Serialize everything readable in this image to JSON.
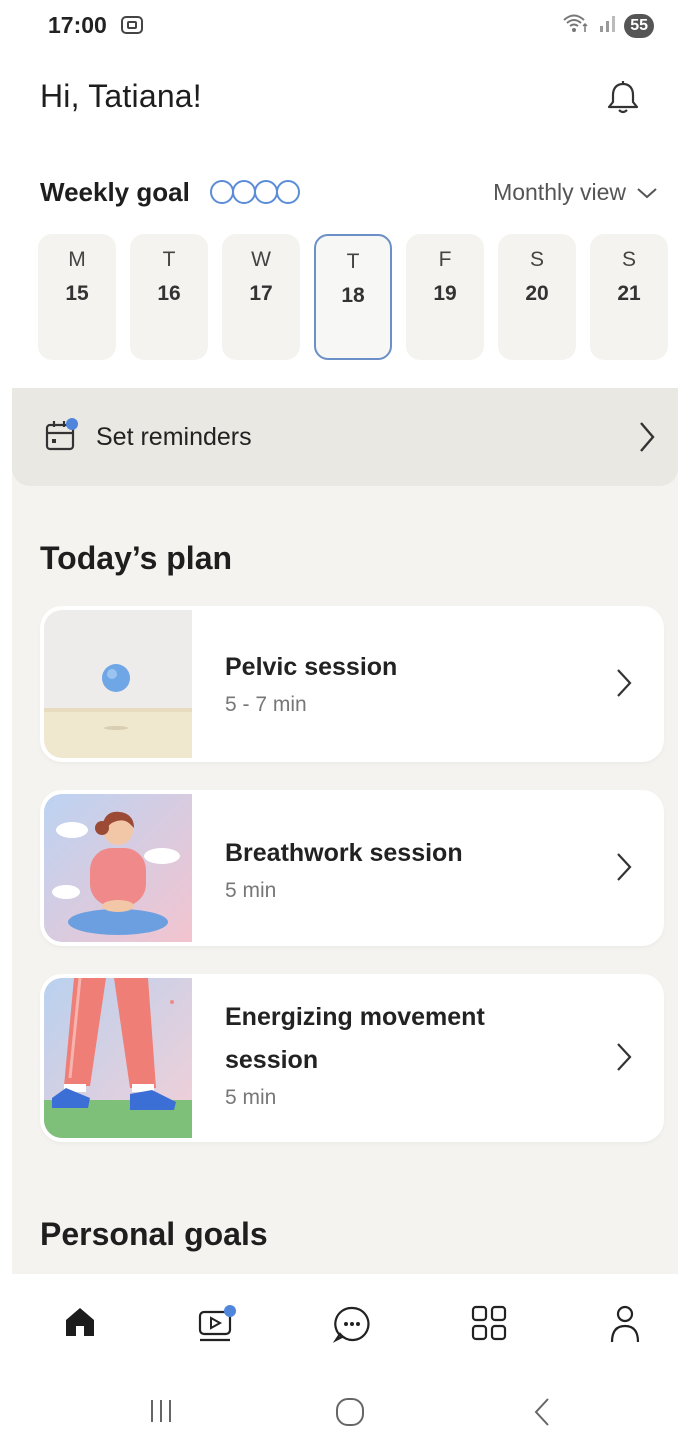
{
  "status_bar": {
    "time": "17:00",
    "battery": "55"
  },
  "header": {
    "greeting": "Hi, Tatiana!"
  },
  "weekly_goal": {
    "title": "Weekly goal",
    "circles_completed": 0,
    "circles_total": 4,
    "view_selector": "Monthly view"
  },
  "days": [
    {
      "letter": "M",
      "number": "15",
      "selected": false
    },
    {
      "letter": "T",
      "number": "16",
      "selected": false
    },
    {
      "letter": "W",
      "number": "17",
      "selected": false
    },
    {
      "letter": "T",
      "number": "18",
      "selected": true
    },
    {
      "letter": "F",
      "number": "19",
      "selected": false
    },
    {
      "letter": "S",
      "number": "20",
      "selected": false
    },
    {
      "letter": "S",
      "number": "21",
      "selected": false
    }
  ],
  "reminders": {
    "label": "Set reminders"
  },
  "today_plan": {
    "title": "Today’s plan",
    "items": [
      {
        "title": "Pelvic session",
        "duration": "5 - 7 min"
      },
      {
        "title": "Breathwork session",
        "duration": "5 min"
      },
      {
        "title_line1": "Energizing movement",
        "title_line2": "session",
        "duration": "5 min"
      }
    ]
  },
  "personal_goals": {
    "title": "Personal goals"
  },
  "bottom_nav": {
    "items": [
      "home-icon",
      "video-icon",
      "chat-icon",
      "grid-icon",
      "profile-icon"
    ],
    "active": "home-icon"
  },
  "colors": {
    "accent": "#5b8cd8",
    "background_beige": "#f4f3ef",
    "card": "#ffffff"
  }
}
